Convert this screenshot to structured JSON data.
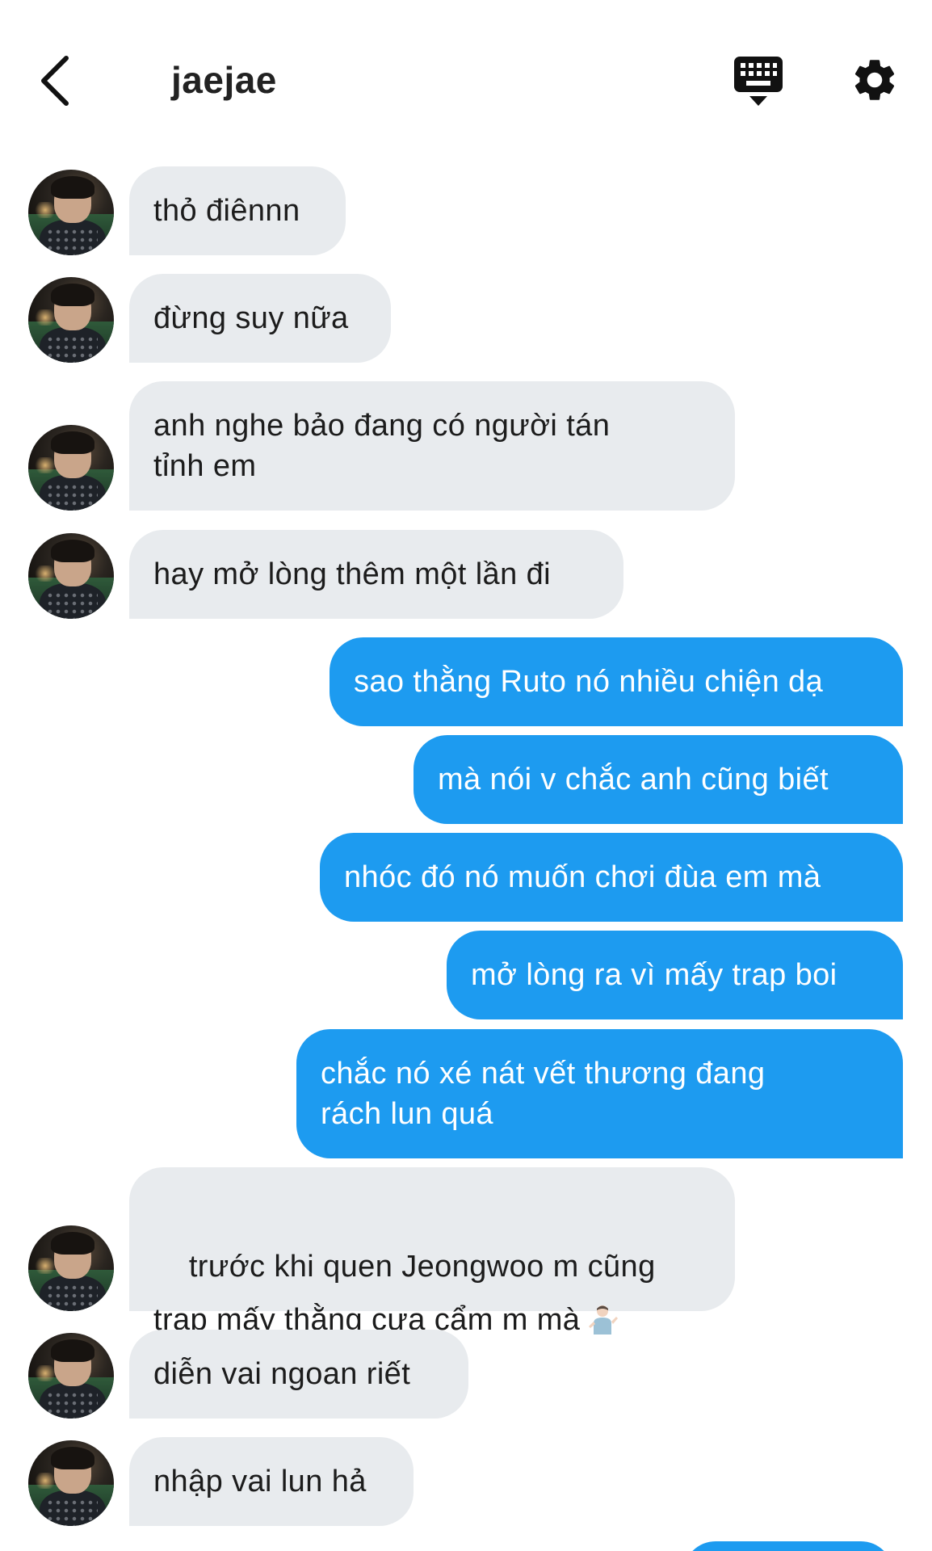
{
  "header": {
    "title": "jaejae",
    "back_icon": "chevron-left-icon",
    "keyboard_icon": "keyboard-icon",
    "settings_icon": "gear-icon"
  },
  "colors": {
    "incoming_bubble": "#e8ebee",
    "outgoing_bubble": "#1d9bf0",
    "text_dark": "#1c1c1c",
    "text_light": "#ffffff"
  },
  "messages": [
    {
      "side": "in",
      "text": "thỏ điênnn"
    },
    {
      "side": "in",
      "text": "đừng suy nữa"
    },
    {
      "side": "in",
      "text": "anh nghe bảo đang có người tán\ntỉnh em"
    },
    {
      "side": "in",
      "text": "hay mở lòng thêm một lần đi"
    },
    {
      "side": "out",
      "text": "sao thằng Ruto nó nhiều chiện dạ"
    },
    {
      "side": "out",
      "text": "mà nói v chắc anh cũng biết"
    },
    {
      "side": "out",
      "text": "nhóc đó nó muốn chơi đùa em mà"
    },
    {
      "side": "out",
      "text": "mở lòng ra vì mấy trap boi"
    },
    {
      "side": "out",
      "text": "chắc nó xé nát vết thương đang\nrách lun quá"
    },
    {
      "side": "in",
      "text": "trước khi quen Jeongwoo m cũng\ntrap mấy thằng cưa cẩm m mà",
      "emoji": "person-shrugging-icon"
    },
    {
      "side": "in",
      "text": "diễn vai ngoan riết"
    },
    {
      "side": "in",
      "text": "nhập vai lun hả"
    }
  ]
}
